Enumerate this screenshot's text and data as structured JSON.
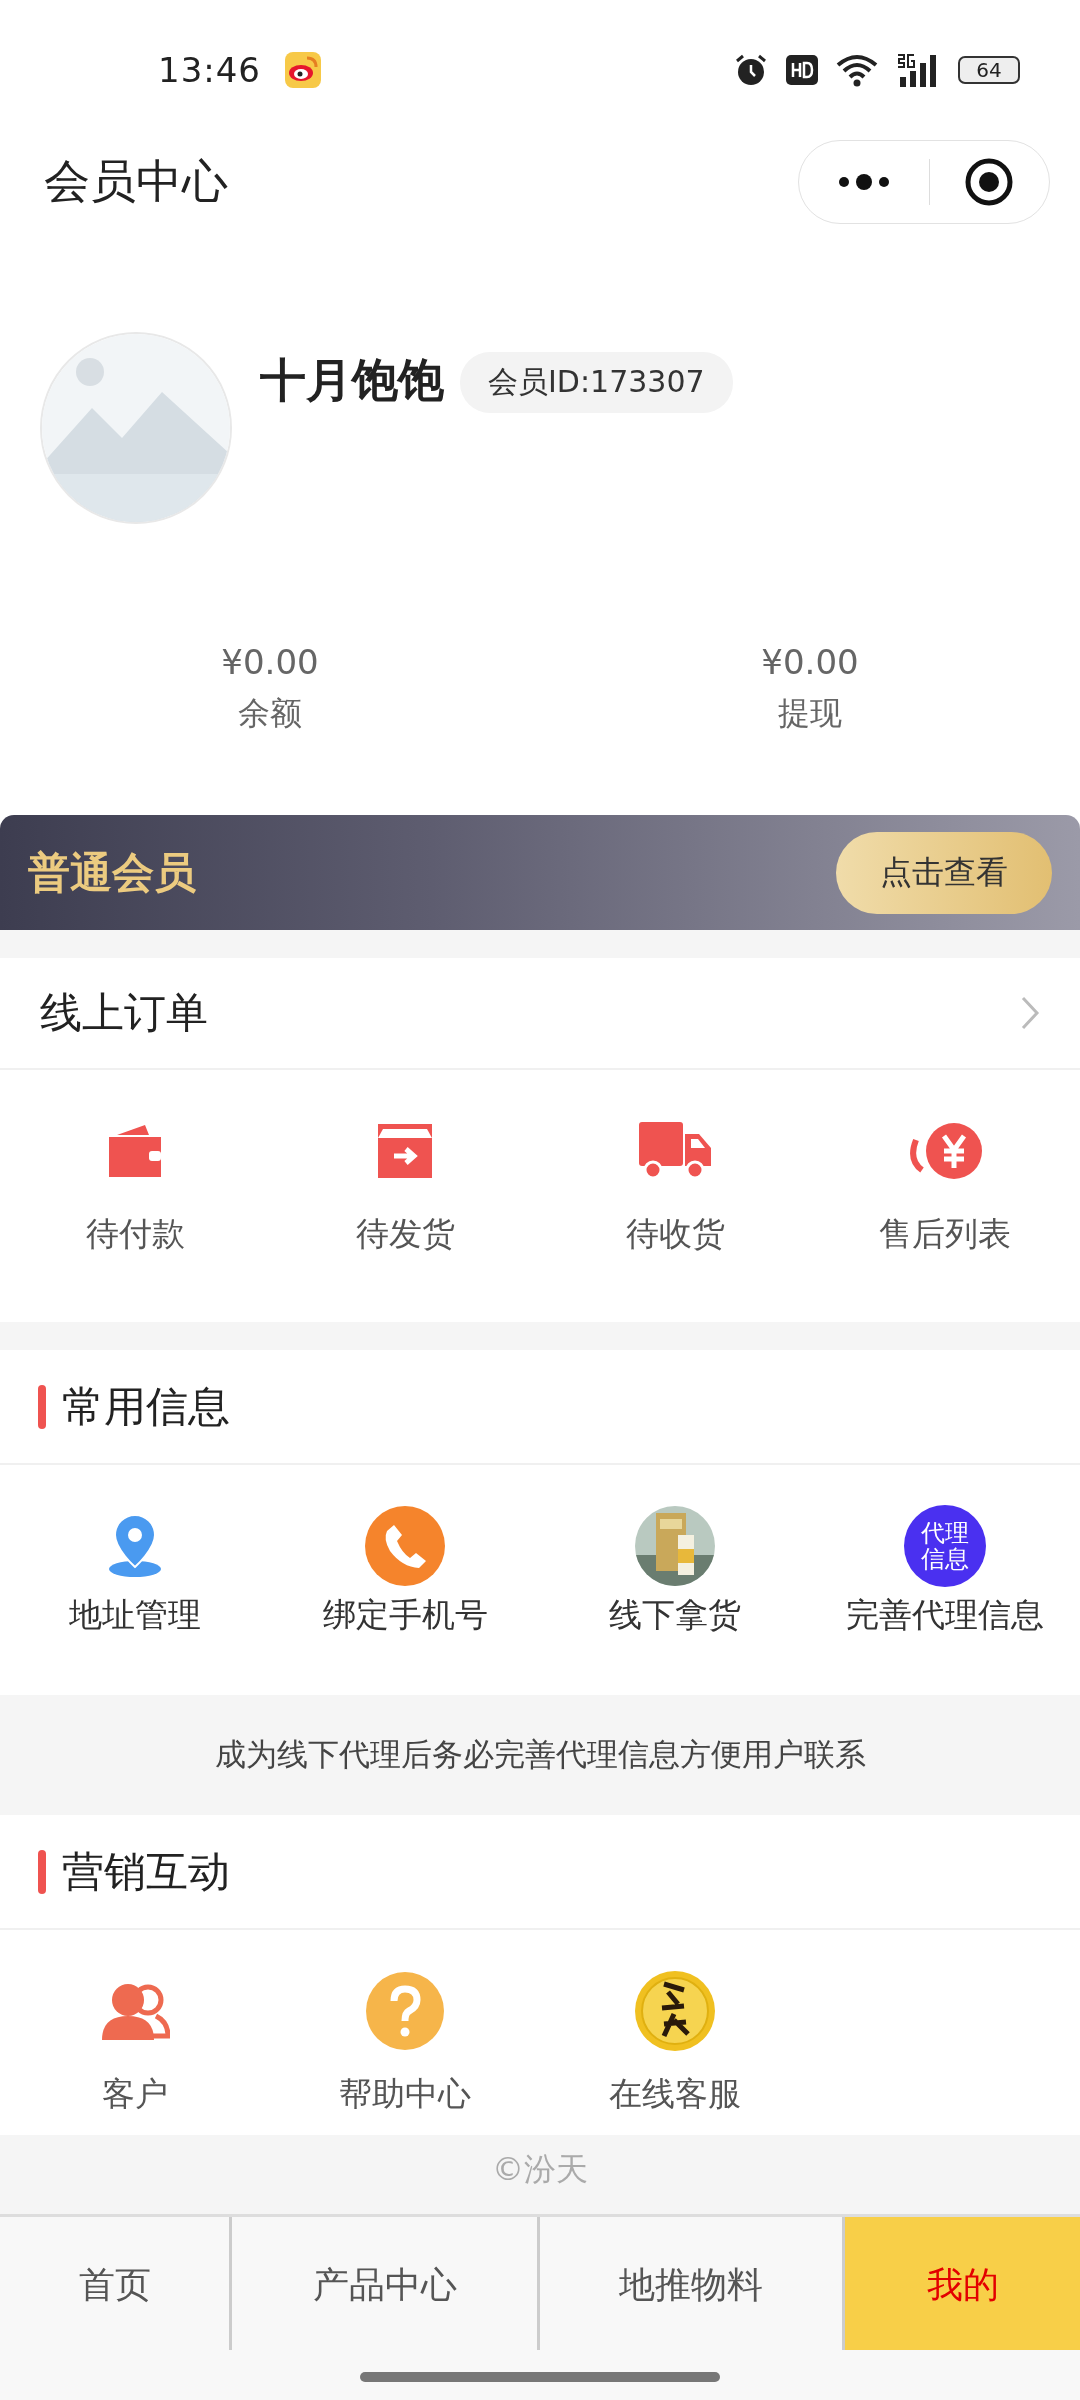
{
  "status_bar": {
    "time": "13:46",
    "battery": "64"
  },
  "header": {
    "title": "会员中心"
  },
  "profile": {
    "name": "十月饱饱",
    "member_id": "会员ID:173307"
  },
  "balances": [
    {
      "amount": "¥0.00",
      "label": "余额"
    },
    {
      "amount": "¥0.00",
      "label": "提现"
    }
  ],
  "membership": {
    "level": "普通会员",
    "button": "点击查看"
  },
  "orders": {
    "title": "线上订单",
    "items": [
      {
        "label": "待付款",
        "kind": "wallet"
      },
      {
        "label": "待发货",
        "kind": "box"
      },
      {
        "label": "待收货",
        "kind": "truck"
      },
      {
        "label": "售后列表",
        "kind": "refund"
      }
    ]
  },
  "common_info": {
    "title": "常用信息",
    "items": [
      {
        "label": "地址管理",
        "kind": "pin"
      },
      {
        "label": "绑定手机号",
        "kind": "phone"
      },
      {
        "label": "线下拿货",
        "kind": "picture"
      },
      {
        "label": "完善代理信息",
        "kind": "badge",
        "badge": [
          "代理",
          "信息"
        ]
      }
    ],
    "note": "成为线下代理后务必完善代理信息方便用户联系"
  },
  "marketing": {
    "title": "营销互动",
    "items": [
      {
        "label": "客户",
        "kind": "users"
      },
      {
        "label": "帮助中心",
        "kind": "help"
      },
      {
        "label": "在线客服",
        "kind": "seal"
      }
    ]
  },
  "footer": {
    "copyright": "©汾天"
  },
  "tab_bar": [
    {
      "label": "首页",
      "selected": false
    },
    {
      "label": "产品中心",
      "selected": false
    },
    {
      "label": "地推物料",
      "selected": false
    },
    {
      "label": "我的",
      "selected": true
    }
  ]
}
